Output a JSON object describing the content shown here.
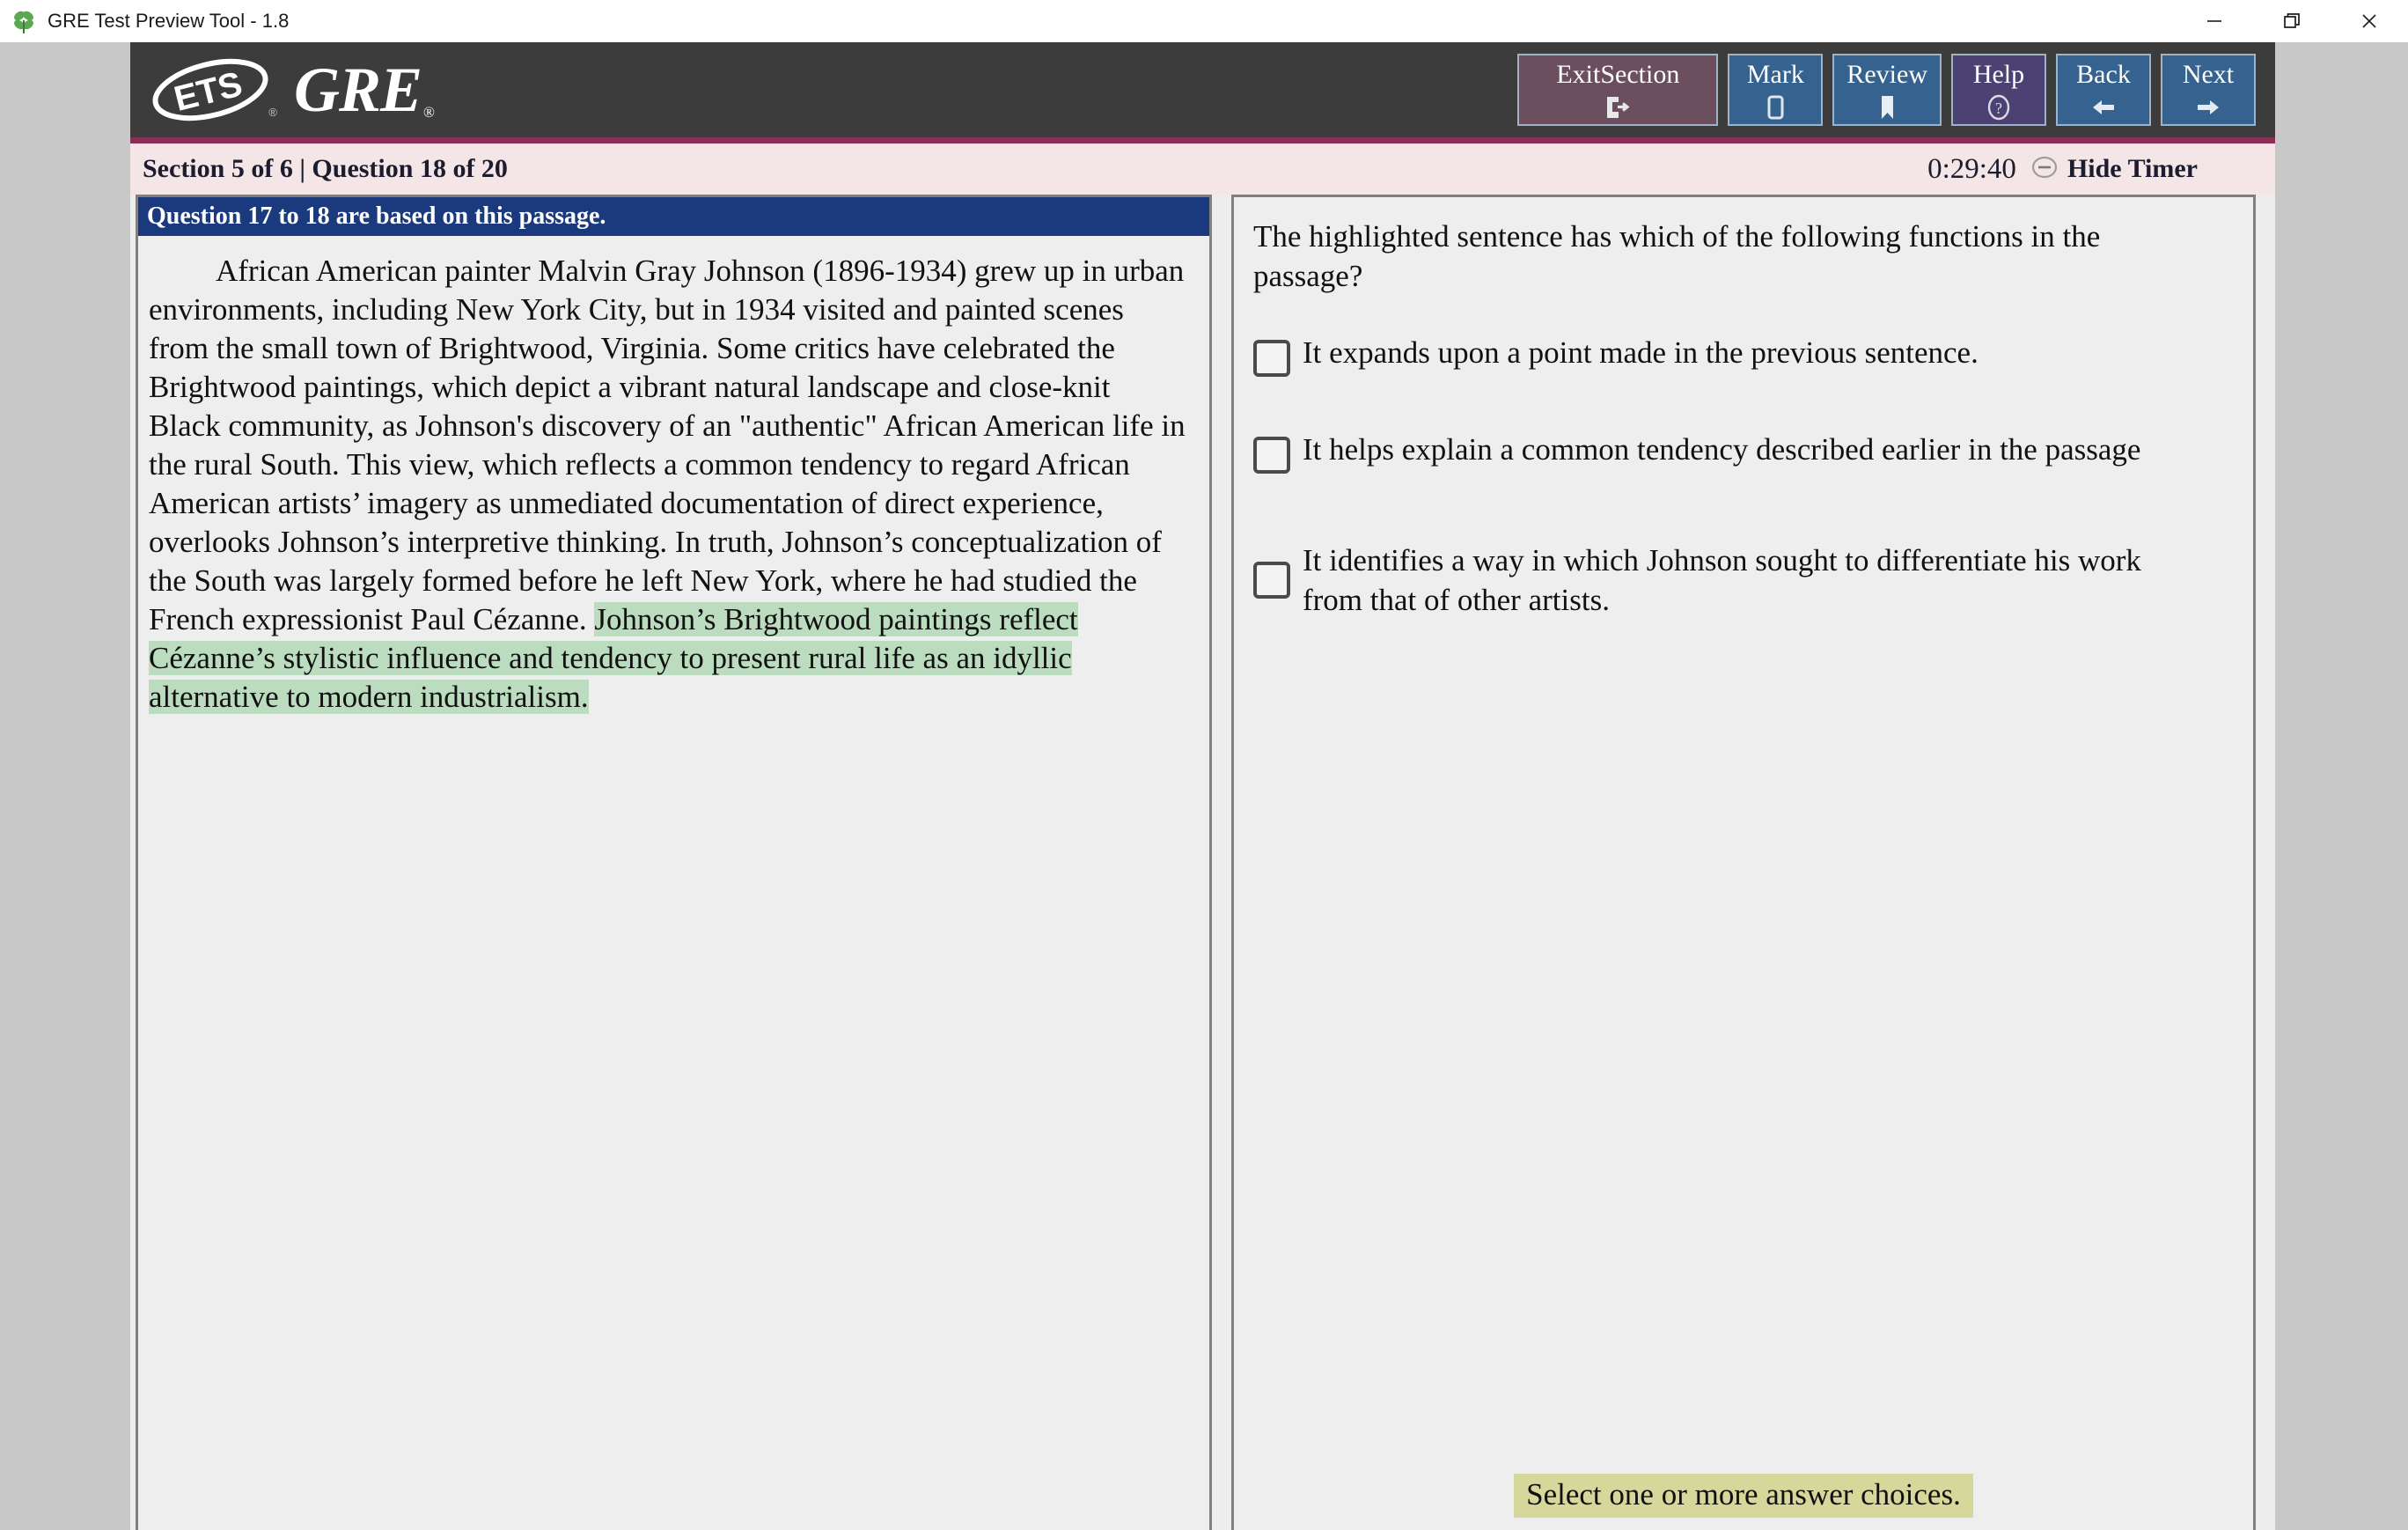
{
  "window": {
    "title": "GRE Test Preview Tool - 1.8",
    "app_icon": "clover-icon",
    "controls": {
      "minimize": "—",
      "maximize": "❐",
      "close": "✕"
    }
  },
  "header": {
    "logo_ets": "ETS",
    "logo_ets_reg": "®",
    "logo_gre": "GRE",
    "logo_gre_reg": "®",
    "buttons": [
      {
        "label": "ExitSection",
        "icon": "exit-door-icon",
        "glyph": "↦",
        "color": "#6c4f5e"
      },
      {
        "label": "Mark",
        "icon": "empty-square-icon",
        "glyph": "□",
        "color": "#35628f"
      },
      {
        "label": "Review",
        "icon": "bookmark-icon",
        "glyph": "⚑",
        "color": "#35628f"
      },
      {
        "label": "Help",
        "icon": "question-circle-icon",
        "glyph": "?",
        "color": "#4b4273"
      },
      {
        "label": "Back",
        "icon": "arrow-left-icon",
        "glyph": "←",
        "color": "#35628f"
      },
      {
        "label": "Next",
        "icon": "arrow-right-icon",
        "glyph": "→",
        "color": "#35628f"
      }
    ]
  },
  "infobar": {
    "section_text": "Section 5 of 6 | Question 18 of 20",
    "timer_value": "0:29:40",
    "hide_timer_label": "Hide Timer",
    "hide_timer_icon": "circle-minus-icon",
    "background": "#f4e5e6"
  },
  "passage": {
    "header": "Question 17 to 18 are based on this passage.",
    "header_background": "#1b3a7e",
    "highlight_color": "#bcdcc0",
    "text_before_highlight": "African American painter Malvin Gray Johnson (1896-1934) grew up in urban environments, including New York City, but in 1934 visited and painted scenes from the small town of Brightwood, Virginia. Some critics have celebrated the Brightwood paintings, which depict a vibrant natural landscape and close-knit Black community, as Johnson's discovery of an \"authentic\" African American life in the rural South. This view, which reflects a common tendency to regard African American artists’ imagery as unmediated documentation of direct experience, overlooks Johnson’s interpretive thinking. In truth, Johnson’s conceptualization of the South was largely formed before he left New York, where he had studied the French expressionist Paul Cézanne. ",
    "highlighted_sentence": "Johnson’s Brightwood paintings reflect Cézanne’s stylistic influence and tendency to present rural life as an idyllic alternative to modern industrialism."
  },
  "question": {
    "stem": "The highlighted sentence has which of the following functions in the passage?",
    "choices": [
      {
        "text": "It expands upon a point made in the previous sentence.",
        "checked": false
      },
      {
        "text": "It helps explain a common tendency described earlier in the passage",
        "checked": false
      },
      {
        "text": "It identifies a way in which Johnson sought to differentiate his work from that of other artists.",
        "checked": false
      }
    ],
    "instruction": "Select one or more answer choices.",
    "instruction_background": "#d6d79a"
  }
}
